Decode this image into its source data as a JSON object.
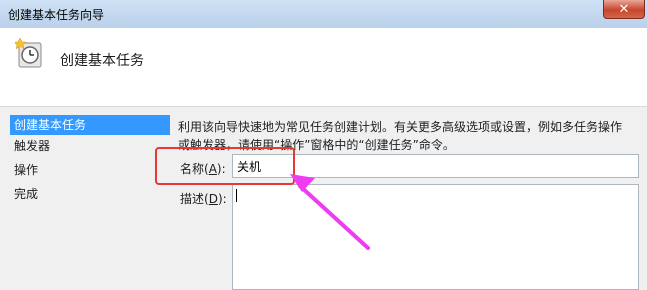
{
  "window": {
    "title": "创建基本任务向导",
    "close_glyph": "✕"
  },
  "header": {
    "title": "创建基本任务",
    "icon": "clock-task-icon"
  },
  "steps": [
    "创建基本任务",
    "触发器",
    "操作",
    "完成"
  ],
  "description": "利用该向导快速地为常见任务创建计划。有关更多高级选项或设置，例如多任务操作或触发器，请使用“操作”窗格中的“创建任务”命令。",
  "form": {
    "name_label": "名称",
    "name_key": "A",
    "name_value": "关机",
    "desc_label": "描述",
    "desc_key": "D",
    "desc_value": ""
  },
  "colors": {
    "accent": "#3399ff",
    "annotation_box": "#e53935",
    "annotation_arrow": "#ee3cf0"
  }
}
